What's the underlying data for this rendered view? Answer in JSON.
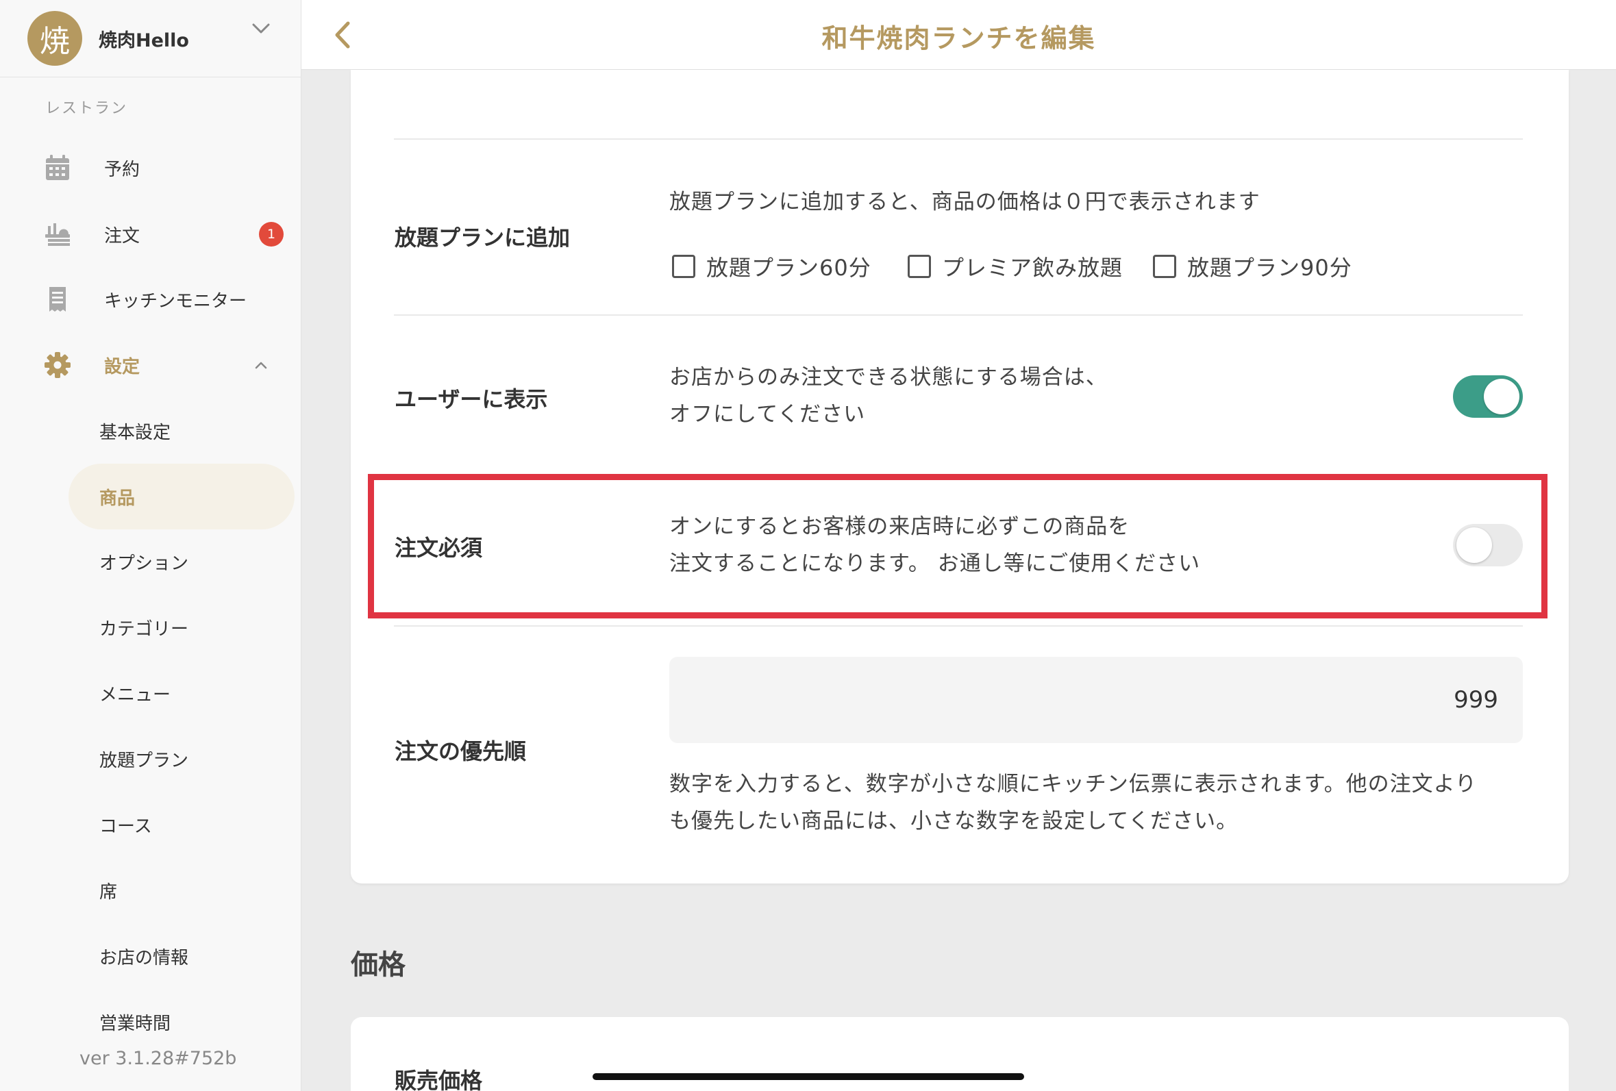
{
  "sidebar": {
    "avatar": "焼",
    "shop_name": "焼肉Hello",
    "section": "レストラン",
    "items": [
      {
        "label": "予約"
      },
      {
        "label": "注文",
        "badge": "1"
      },
      {
        "label": "キッチンモニター"
      },
      {
        "label": "設定"
      }
    ],
    "sub_items": [
      {
        "label": "基本設定"
      },
      {
        "label": "商品"
      },
      {
        "label": "オプション"
      },
      {
        "label": "カテゴリー"
      },
      {
        "label": "メニュー"
      },
      {
        "label": "放題プラン"
      },
      {
        "label": "コース"
      },
      {
        "label": "席"
      },
      {
        "label": "お店の情報"
      },
      {
        "label": "営業時間"
      }
    ],
    "version": "ver 3.1.28#752b"
  },
  "header": {
    "title": "和牛焼肉ランチを編集"
  },
  "form": {
    "plan": {
      "label": "放題プランに追加",
      "desc": "放題プランに追加すると、商品の価格は０円で表示されます",
      "options": [
        "放題プラン60分",
        "プレミア飲み放題",
        "放題プラン90分"
      ]
    },
    "show_user": {
      "label": "ユーザーに表示",
      "desc_1": "お店からのみ注文できる状態にする場合は、",
      "desc_2": "オフにしてください",
      "enabled": true
    },
    "required": {
      "label": "注文必須",
      "desc_1": "オンにするとお客様の来店時に必ずこの商品を",
      "desc_2": "注文することになります。 お通し等にご使用ください",
      "enabled": false
    },
    "priority": {
      "label": "注文の優先順",
      "value": "999",
      "desc_1": "数字を入力すると、数字が小さな順にキッチン伝票に表示されます。他の注文より",
      "desc_2": "も優先したい商品には、小さな数字を設定してください。"
    }
  },
  "price_section": {
    "title": "価格",
    "sale_price_label": "販売価格"
  },
  "colors": {
    "accent": "#b59960",
    "toggle_on": "#3c9d88",
    "badge": "#e24a3b",
    "highlight": "#e03442"
  }
}
